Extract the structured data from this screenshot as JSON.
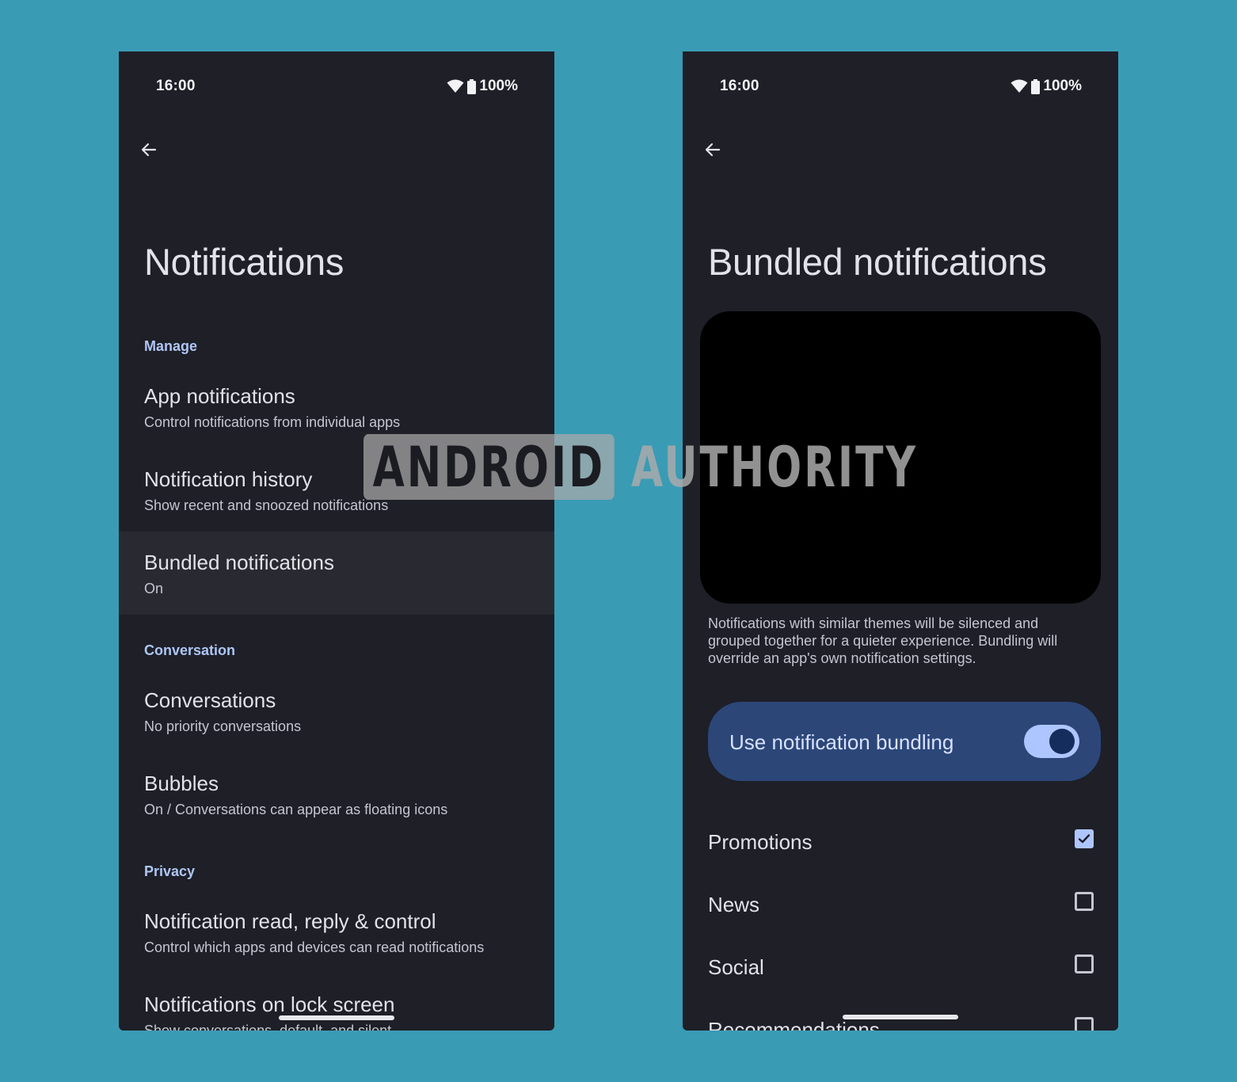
{
  "watermark": {
    "part1": "ANDROID",
    "part2": "AUTHORITY"
  },
  "left": {
    "status": {
      "time": "16:00",
      "battery": "100%",
      "icons": [
        "wifi-icon",
        "battery-icon"
      ]
    },
    "back_icon": "arrow-back-icon",
    "title": "Notifications",
    "sections": [
      {
        "header": "Manage",
        "items": [
          {
            "title": "App notifications",
            "subtitle": "Control notifications from individual apps"
          },
          {
            "title": "Notification history",
            "subtitle": "Show recent and snoozed notifications"
          },
          {
            "title": "Bundled notifications",
            "subtitle": "On",
            "highlighted": true
          }
        ]
      },
      {
        "header": "Conversation",
        "items": [
          {
            "title": "Conversations",
            "subtitle": "No priority conversations"
          },
          {
            "title": "Bubbles",
            "subtitle": "On / Conversations can appear as floating icons"
          }
        ]
      },
      {
        "header": "Privacy",
        "items": [
          {
            "title": "Notification read, reply & control",
            "subtitle": "Control which apps and devices can read notifications"
          },
          {
            "title": "Notifications on lock screen",
            "subtitle": "Show conversations, default, and silent"
          }
        ]
      }
    ]
  },
  "right": {
    "status": {
      "time": "16:00",
      "battery": "100%",
      "icons": [
        "wifi-icon",
        "battery-icon"
      ]
    },
    "back_icon": "arrow-back-icon",
    "title": "Bundled notifications",
    "description": "Notifications with similar themes will be silenced and grouped together for a quieter experience. Bundling will override an app's own notification settings.",
    "toggle": {
      "label": "Use notification bundling",
      "on": true
    },
    "categories": [
      {
        "label": "Promotions",
        "checked": true
      },
      {
        "label": "News",
        "checked": false
      },
      {
        "label": "Social",
        "checked": false
      },
      {
        "label": "Recommendations",
        "checked": false
      }
    ]
  },
  "colors": {
    "background": "#3a9bb5",
    "surface": "#1e1f27",
    "highlight": "#292a31",
    "accent": "#aec6f6",
    "toggle_card": "#2c4678",
    "switch_track": "#aec6ff",
    "switch_thumb": "#142d5c"
  }
}
